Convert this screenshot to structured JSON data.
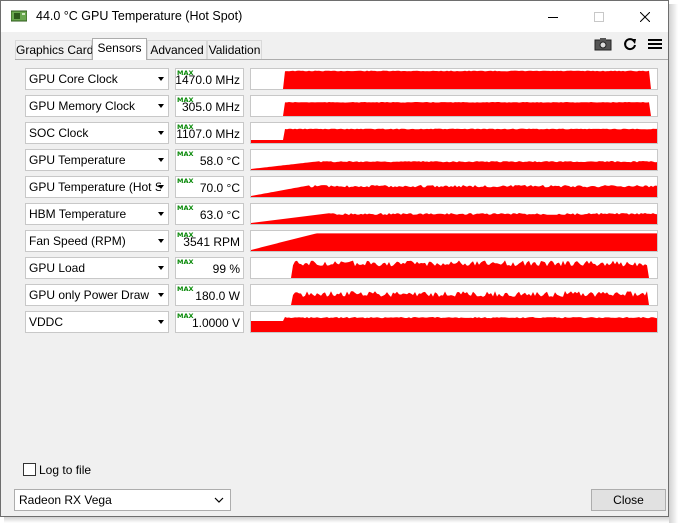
{
  "window": {
    "title": "44.0 °C GPU Temperature (Hot Spot)",
    "controls": {
      "minimize": "minimize-icon",
      "maximize": "maximize-icon",
      "close": "close-icon"
    }
  },
  "tabs": [
    {
      "label": "Graphics Card",
      "active": false
    },
    {
      "label": "Sensors",
      "active": true
    },
    {
      "label": "Advanced",
      "active": false
    },
    {
      "label": "Validation",
      "active": false
    }
  ],
  "toolbar": {
    "icons": [
      "camera-icon",
      "refresh-icon",
      "menu-icon"
    ]
  },
  "sensors": [
    {
      "name": "GPU Core Clock",
      "value": "1470.0 MHz",
      "badge": "MAX"
    },
    {
      "name": "GPU Memory Clock",
      "value": "305.0 MHz",
      "badge": "MAX"
    },
    {
      "name": "SOC Clock",
      "value": "1107.0 MHz",
      "badge": "MAX"
    },
    {
      "name": "GPU Temperature",
      "value": "58.0 °C",
      "badge": "MAX"
    },
    {
      "name": "GPU Temperature (Hot Spot)",
      "value": "70.0 °C",
      "badge": "MAX"
    },
    {
      "name": "HBM Temperature",
      "value": "63.0 °C",
      "badge": "MAX"
    },
    {
      "name": "Fan Speed (RPM)",
      "value": "3541 RPM",
      "badge": "MAX"
    },
    {
      "name": "GPU Load",
      "value": "99 %",
      "badge": "MAX"
    },
    {
      "name": "GPU only Power Draw",
      "value": "180.0 W",
      "badge": "MAX"
    },
    {
      "name": "VDDC",
      "value": "1.0000 V",
      "badge": "MAX"
    }
  ],
  "graph_color": "#ff0000",
  "log_to_file": {
    "label": "Log to file",
    "checked": false
  },
  "gpu_select": {
    "value": "Radeon RX Vega"
  },
  "close_button": {
    "label": "Close"
  }
}
